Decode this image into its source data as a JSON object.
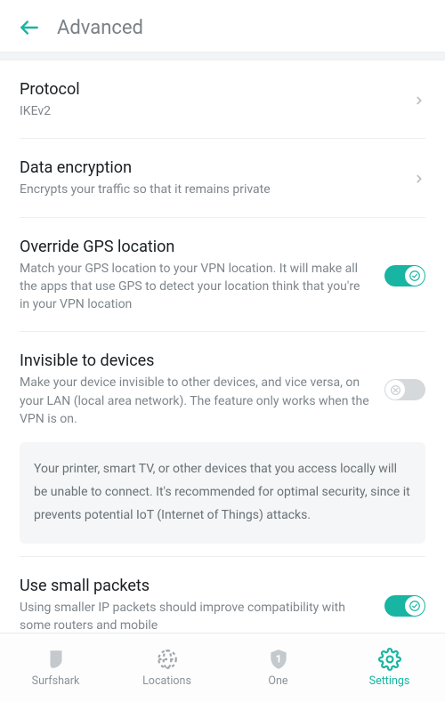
{
  "header": {
    "title": "Advanced"
  },
  "settings": {
    "protocol": {
      "title": "Protocol",
      "value": "IKEv2"
    },
    "data_encryption": {
      "title": "Data encryption",
      "subtitle": "Encrypts your traffic so that it remains private"
    },
    "override_gps": {
      "title": "Override GPS location",
      "subtitle": "Match your GPS location to your VPN location. It will make all the apps that use GPS to detect your location think that you're in your VPN location",
      "enabled": true
    },
    "invisible": {
      "title": "Invisible to devices",
      "subtitle": "Make your device invisible to other devices, and vice versa, on your LAN (local area network). The feature only works when the VPN is on.",
      "enabled": false,
      "note": "Your printer, smart TV, or other devices that you access locally will be unable to connect. It's recommended for optimal security, since it prevents potential IoT (Internet of Things) attacks."
    },
    "small_packets": {
      "title": "Use small packets",
      "subtitle": "Using smaller IP packets should improve compatibility with some routers and mobile",
      "enabled": true
    }
  },
  "nav": {
    "surfshark": "Surfshark",
    "locations": "Locations",
    "one": "One",
    "settings": "Settings"
  },
  "colors": {
    "accent": "#17b5a2",
    "muted": "#7e868b"
  }
}
